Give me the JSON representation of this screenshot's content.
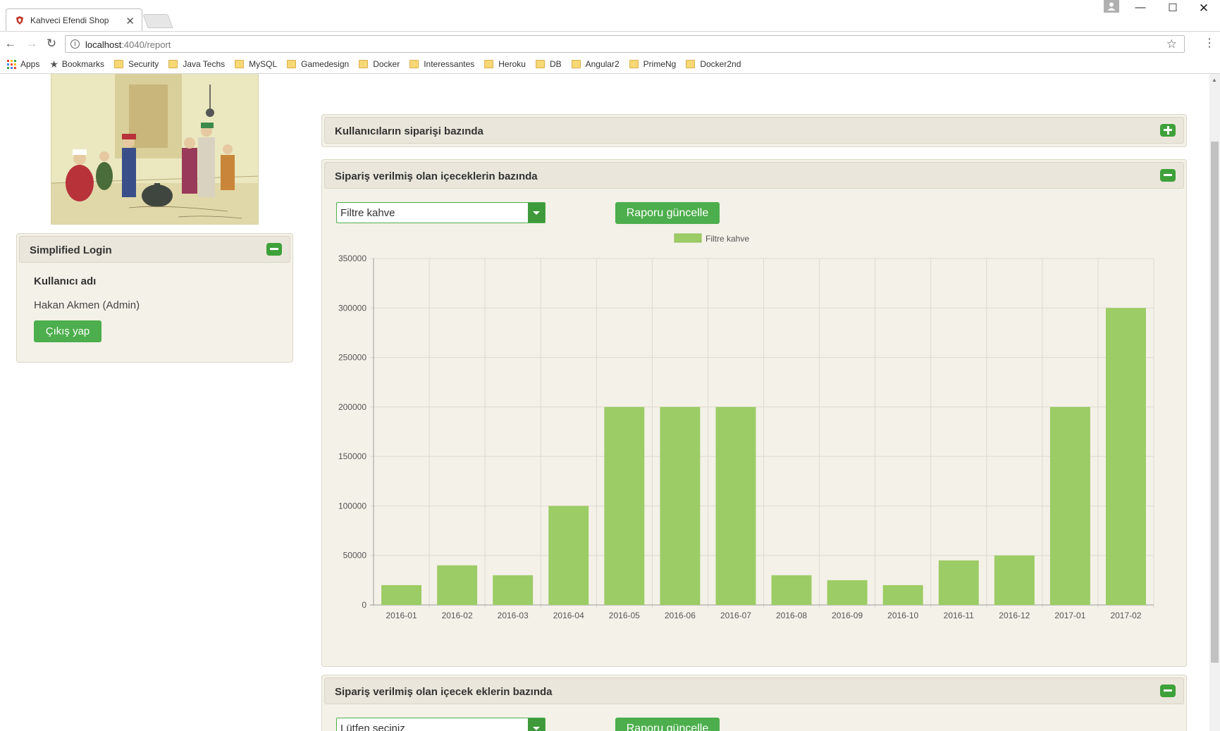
{
  "browser": {
    "tab_title": "Kahveci Efendi Shop",
    "url_host": "localhost",
    "url_path": ":4040/report",
    "bookmarks": [
      "Apps",
      "Bookmarks",
      "Security",
      "Java Techs",
      "MySQL",
      "Gamedesign",
      "Docker",
      "Interessantes",
      "Heroku",
      "DB",
      "Angular2",
      "PrimeNg",
      "Docker2nd"
    ]
  },
  "login_panel": {
    "title": "Simplified Login",
    "username_label": "Kullanıcı adı",
    "username_value": "Hakan Akmen (Admin)",
    "logout_label": "Çıkış yap"
  },
  "panels": {
    "users": {
      "title": "Kullanıcıların siparişi bazında"
    },
    "drinks": {
      "title": "Sipariş verilmiş olan içeceklerin bazında",
      "select_value": "Filtre kahve",
      "update_label": "Raporu güncelle"
    },
    "extras": {
      "title": "Sipariş verilmiş olan içecek eklerin bazında",
      "select_value": "Lütfen seçiniz",
      "update_label": "Raporu güncelle"
    }
  },
  "colors": {
    "accent": "#4cae4c",
    "bar": "#9ccc65",
    "panel_bg": "#f4f1e8"
  },
  "chart_data": {
    "type": "bar",
    "categories": [
      "2016-01",
      "2016-02",
      "2016-03",
      "2016-04",
      "2016-05",
      "2016-06",
      "2016-07",
      "2016-08",
      "2016-09",
      "2016-10",
      "2016-11",
      "2016-12",
      "2017-01",
      "2017-02"
    ],
    "series": [
      {
        "name": "Filtre kahve",
        "values": [
          20000,
          40000,
          30000,
          100000,
          200000,
          200000,
          200000,
          30000,
          25000,
          20000,
          45000,
          50000,
          200000,
          300000
        ]
      }
    ],
    "yticks": [
      0,
      50000,
      100000,
      150000,
      200000,
      250000,
      300000,
      350000
    ],
    "ylim": [
      0,
      350000
    ],
    "grid": true,
    "legend_position": "top"
  }
}
